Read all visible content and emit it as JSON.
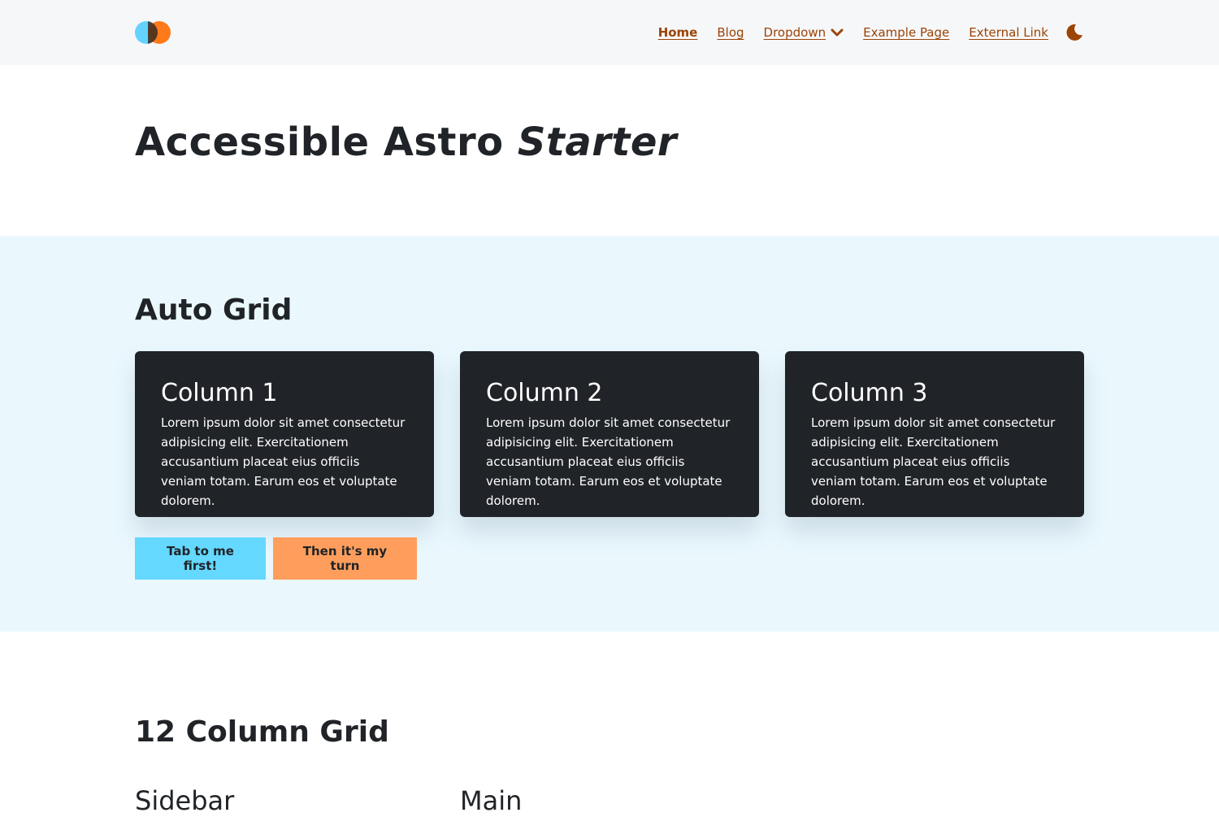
{
  "header": {
    "nav": {
      "home": "Home",
      "blog": "Blog",
      "dropdown": "Dropdown",
      "example": "Example Page",
      "external": "External Link"
    }
  },
  "hero": {
    "title_main": "Accessible Astro ",
    "title_em": "Starter"
  },
  "auto_grid": {
    "title": "Auto Grid",
    "cards": [
      {
        "title": "Column 1",
        "text": "Lorem ipsum dolor sit amet consectetur adipisicing elit. Exercitationem accusantium placeat eius officiis veniam totam. Earum eos et voluptate dolorem."
      },
      {
        "title": "Column 2",
        "text": "Lorem ipsum dolor sit amet consectetur adipisicing elit. Exercitationem accusantium placeat eius officiis veniam totam. Earum eos et voluptate dolorem."
      },
      {
        "title": "Column 3",
        "text": "Lorem ipsum dolor sit amet consectetur adipisicing elit. Exercitationem accusantium placeat eius officiis veniam totam. Earum eos et voluptate dolorem."
      }
    ],
    "buttons": {
      "primary": "Tab to me first!",
      "secondary": "Then it's my turn"
    }
  },
  "twelve_grid": {
    "title": "12 Column Grid",
    "sidebar": "Sidebar",
    "main": "Main"
  },
  "colors": {
    "accent": "#9c4306",
    "header_bg": "#f6f7f9",
    "section_bg": "#eaf8fe",
    "card_bg": "#202327",
    "button_primary": "#64d8ff",
    "button_secondary": "#ff9e5c"
  },
  "icons": {
    "logo": "logo-icon",
    "dropdown": "chevron-down-icon",
    "theme": "moon-icon"
  }
}
